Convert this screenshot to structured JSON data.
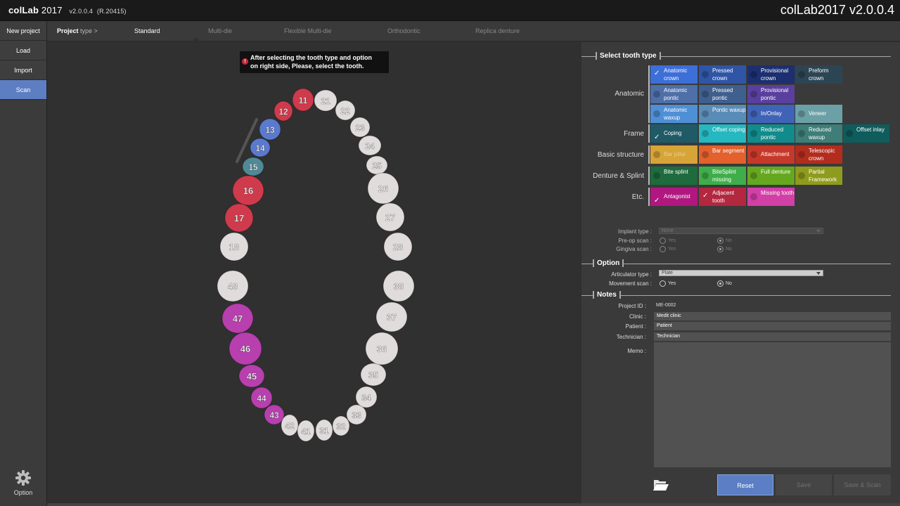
{
  "app": {
    "brand": "colLab",
    "brand_year": "2017",
    "version_label": "v2.0.0.4",
    "revision_label": "(R.20415)",
    "title_right": "colLab2017 v2.0.0.4"
  },
  "sidebar": {
    "items": [
      {
        "label": "New project"
      },
      {
        "label": "Load"
      },
      {
        "label": "Import"
      },
      {
        "label": "Scan"
      }
    ],
    "option_label": "Option"
  },
  "tabs": {
    "project_type": "Project",
    "project_type_suffix": "type >",
    "items": [
      {
        "label": "Standard"
      },
      {
        "label": "Multi-die"
      },
      {
        "label": "Flexible Multi-die"
      },
      {
        "label": "Orthodontic"
      },
      {
        "label": "Replica denture"
      }
    ]
  },
  "tooltip": {
    "line1": "After selecting the tooth type and option",
    "line2": "on right side, Please, select the tooth."
  },
  "arch": {
    "teeth": [
      {
        "num": "11",
        "color": "#cf3b4c"
      },
      {
        "num": "12",
        "color": "#cf3b4c"
      },
      {
        "num": "13",
        "color": "#5a7ad0"
      },
      {
        "num": "14",
        "color": "#5a7ad0"
      },
      {
        "num": "15",
        "color": "#4f8a96"
      },
      {
        "num": "16",
        "color": "#cf3b4c"
      },
      {
        "num": "17",
        "color": "#cf3b4c"
      },
      {
        "num": "18",
        "color": "#e0dcdc"
      },
      {
        "num": "21",
        "color": "#e0dcdc"
      },
      {
        "num": "22",
        "color": "#e0dcdc"
      },
      {
        "num": "23",
        "color": "#e0dcdc"
      },
      {
        "num": "24",
        "color": "#e0dcdc"
      },
      {
        "num": "25",
        "color": "#e0dcdc"
      },
      {
        "num": "26",
        "color": "#e0dcdc"
      },
      {
        "num": "27",
        "color": "#e0dcdc"
      },
      {
        "num": "28",
        "color": "#e0dcdc"
      },
      {
        "num": "48",
        "color": "#e0dcdc"
      },
      {
        "num": "47",
        "color": "#b73fae"
      },
      {
        "num": "46",
        "color": "#b73fae"
      },
      {
        "num": "45",
        "color": "#b73fae"
      },
      {
        "num": "44",
        "color": "#b73fae"
      },
      {
        "num": "43",
        "color": "#b73fae"
      },
      {
        "num": "42",
        "color": "#e0dcdc"
      },
      {
        "num": "41",
        "color": "#e0dcdc"
      },
      {
        "num": "31",
        "color": "#e0dcdc"
      },
      {
        "num": "32",
        "color": "#e0dcdc"
      },
      {
        "num": "33",
        "color": "#e0dcdc"
      },
      {
        "num": "34",
        "color": "#e0dcdc"
      },
      {
        "num": "35",
        "color": "#e0dcdc"
      },
      {
        "num": "36",
        "color": "#e0dcdc"
      },
      {
        "num": "37",
        "color": "#e0dcdc"
      },
      {
        "num": "38",
        "color": "#e0dcdc"
      }
    ]
  },
  "tooth_type": {
    "section_title": "Select tooth type",
    "groups": [
      {
        "label": "Anatomic",
        "items": [
          {
            "label": "Anatomic crown",
            "color": "#3d6fd9",
            "checked": true
          },
          {
            "label": "Pressed crown",
            "color": "#2f55a6",
            "checked": false
          },
          {
            "label": "Provisional crown",
            "color": "#1c2f70",
            "checked": false
          },
          {
            "label": "Preform crown",
            "color": "#2c4553",
            "checked": false
          },
          {
            "label": "Anatomic pontic",
            "color": "#4e6fa8",
            "checked": false
          },
          {
            "label": "Pressed pontic",
            "color": "#3f5f8e",
            "checked": false
          },
          {
            "label": "Provisional pontic",
            "color": "#5a3f9e",
            "checked": false
          },
          {
            "label": "Anatomic waxup",
            "color": "#4f8fd6",
            "checked": false
          },
          {
            "label": "Pontic waxup",
            "color": "#5a8cb8",
            "checked": false
          },
          {
            "label": "In/Onlay",
            "color": "#3f63b6",
            "checked": false
          },
          {
            "label": "Veneer",
            "color": "#6ba0a6",
            "checked": false
          }
        ]
      },
      {
        "label": "Frame",
        "items": [
          {
            "label": "Coping",
            "color": "#1f5a66",
            "checked": true
          },
          {
            "label": "Offset coping",
            "color": "#25b8c0",
            "checked": false
          },
          {
            "label": "Reduced pontic",
            "color": "#128b8c",
            "checked": false
          },
          {
            "label": "Reduced waxup",
            "color": "#3e7e78",
            "checked": false
          },
          {
            "label": "Offset inlay",
            "color": "#0f5c5c",
            "checked": false
          }
        ]
      },
      {
        "label": "Basic structure",
        "items": [
          {
            "label": "Bar pillar",
            "color": "#d6a437",
            "checked": false
          },
          {
            "label": "Bar segment",
            "color": "#e2612c",
            "checked": false
          },
          {
            "label": "Attachment",
            "color": "#c6392a",
            "checked": false
          },
          {
            "label": "Telescopic crown",
            "color": "#b22d1e",
            "checked": false
          }
        ]
      },
      {
        "label": "Denture & Splint",
        "items": [
          {
            "label": "Bite splint",
            "color": "#1e6b3e",
            "checked": false
          },
          {
            "label": "BiteSplint missing",
            "color": "#3fae4a",
            "checked": false
          },
          {
            "label": "Full denture",
            "color": "#65a81f",
            "checked": false
          },
          {
            "label": "Partial Framework",
            "color": "#8f9b1c",
            "checked": false
          }
        ]
      },
      {
        "label": "Etc.",
        "items": [
          {
            "label": "Antagonist",
            "color": "#b0177f",
            "checked": true
          },
          {
            "label": "Adjacent tooth",
            "color": "#b3273f",
            "checked": true
          },
          {
            "label": "Missing tooth",
            "color": "#d23fa6",
            "checked": false
          }
        ]
      }
    ]
  },
  "implant": {
    "implant_type_label": "Implant type :",
    "implant_type_value": "None",
    "preop_label": "Pre-op scan :",
    "gingiva_label": "Gingiva scan :",
    "yes": "Yes",
    "no": "No"
  },
  "option": {
    "section_title": "Option",
    "articulator_label": "Articulator type :",
    "articulator_value": "Plate",
    "movement_label": "Movement scan :",
    "yes": "Yes",
    "no": "No"
  },
  "notes": {
    "section_title": "Notes",
    "project_id_label": "Project ID :",
    "project_id_value": "ME-0002",
    "clinic_label": "Clinic :",
    "clinic_value": "Medit clinic",
    "patient_label": "Patient :",
    "patient_value": "Patient",
    "technician_label": "Technician :",
    "technician_value": "Technician",
    "memo_label": "Memo :"
  },
  "actions": {
    "reset": "Reset",
    "save": "Save",
    "save_scan": "Save & Scan"
  }
}
